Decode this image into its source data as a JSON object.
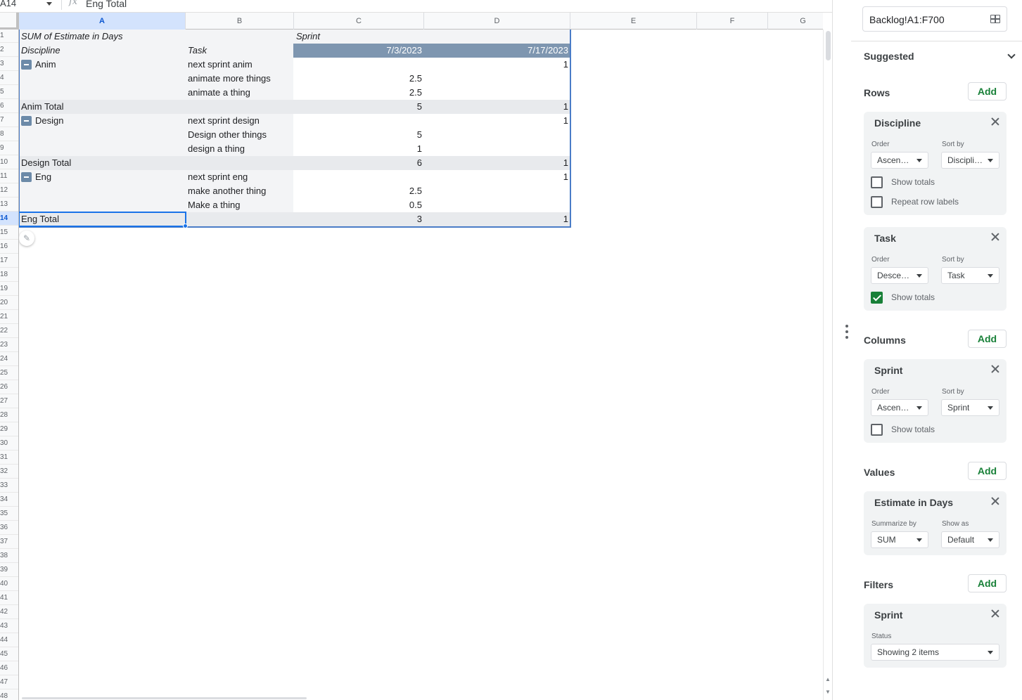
{
  "formula_bar": {
    "cell_ref": "A14",
    "fx": "fx",
    "content": "Eng Total"
  },
  "columns": [
    "A",
    "B",
    "C",
    "D",
    "E",
    "F",
    "G"
  ],
  "rows": [
    "1",
    "2",
    "3",
    "4",
    "5",
    "6",
    "7",
    "8",
    "9",
    "10",
    "11",
    "12",
    "13",
    "14",
    "15",
    "16",
    "17",
    "18",
    "19",
    "20",
    "21",
    "22",
    "23",
    "24",
    "25",
    "26",
    "27",
    "28",
    "29",
    "30",
    "31",
    "32",
    "33",
    "34",
    "35",
    "36",
    "37",
    "38",
    "39",
    "40",
    "41",
    "42",
    "43",
    "44",
    "45",
    "46",
    "47",
    "48"
  ],
  "pivot": {
    "title": "SUM of Estimate in Days",
    "column_field": "Sprint",
    "discipline_header": "Discipline",
    "task_header": "Task",
    "sprint_dates": [
      "7/3/2023",
      "7/17/2023"
    ],
    "groups": [
      {
        "name": "Anim",
        "tasks": [
          {
            "task": "next sprint anim",
            "c": "",
            "d": "1"
          },
          {
            "task": "animate more things",
            "c": "2.5",
            "d": ""
          },
          {
            "task": "animate a thing",
            "c": "2.5",
            "d": ""
          }
        ],
        "total_label": "Anim Total",
        "total_c": "5",
        "total_d": "1"
      },
      {
        "name": "Design",
        "tasks": [
          {
            "task": "next sprint design",
            "c": "",
            "d": "1"
          },
          {
            "task": "Design other things",
            "c": "5",
            "d": ""
          },
          {
            "task": "design a thing",
            "c": "1",
            "d": ""
          }
        ],
        "total_label": "Design Total",
        "total_c": "6",
        "total_d": "1"
      },
      {
        "name": "Eng",
        "tasks": [
          {
            "task": "next sprint eng",
            "c": "",
            "d": "1"
          },
          {
            "task": "make another thing",
            "c": "2.5",
            "d": ""
          },
          {
            "task": "Make a thing",
            "c": "0.5",
            "d": ""
          }
        ],
        "total_label": "Eng Total",
        "total_c": "3",
        "total_d": "1"
      }
    ]
  },
  "panel": {
    "range": "Backlog!A1:F700",
    "suggested": "Suggested",
    "rows_label": "Rows",
    "columns_label": "Columns",
    "values_label": "Values",
    "filters_label": "Filters",
    "add": "Add",
    "order_label": "Order",
    "sort_by_label": "Sort by",
    "summarize_by_label": "Summarize by",
    "show_as_label": "Show as",
    "status_label": "Status",
    "show_totals": "Show totals",
    "repeat_row_labels": "Repeat row labels",
    "discipline_card": {
      "title": "Discipline",
      "order": "Ascendi…",
      "sort_by": "Discipli…",
      "show_totals": false,
      "repeat_row_labels": false
    },
    "task_card": {
      "title": "Task",
      "order": "Descen…",
      "sort_by": "Task",
      "show_totals": true
    },
    "sprint_col_card": {
      "title": "Sprint",
      "order": "Ascendi…",
      "sort_by": "Sprint",
      "show_totals": false
    },
    "values_card": {
      "title": "Estimate in Days",
      "summarize_by": "SUM",
      "show_as": "Default"
    },
    "filter_card": {
      "title": "Sprint",
      "status": "Showing 2 items"
    }
  },
  "colors": {
    "pivot_header": "#7e96b0",
    "total_band": "#e8eaed",
    "selection": "#1a73e8",
    "accent_green": "#188038"
  }
}
